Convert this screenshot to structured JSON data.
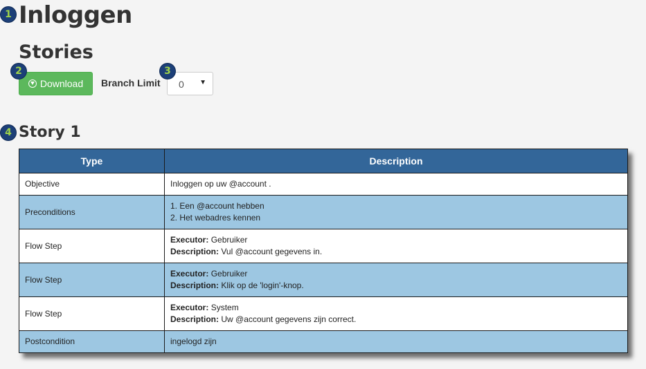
{
  "badges": [
    "1",
    "2",
    "3",
    "4"
  ],
  "page_title": "Inloggen",
  "section_title": "Stories",
  "download_button": {
    "label": "Download",
    "icon": "download-circle-icon",
    "color": "#5cb85c"
  },
  "branch_limit": {
    "label": "Branch Limit",
    "selected": "0"
  },
  "story": {
    "title": "Story 1",
    "headers": [
      "Type",
      "Description"
    ],
    "header_color": "#336699",
    "alt_row_color": "#9dc7e2",
    "rows": [
      {
        "type": "Objective",
        "text": "Inloggen op uw @account ."
      },
      {
        "type": "Preconditions",
        "lines": [
          "1. Een @account hebben",
          "2. Het webadres kennen"
        ]
      },
      {
        "type": "Flow Step",
        "executor_label": "Executor:",
        "executor": "Gebruiker",
        "description_label": "Description:",
        "description": "Vul @account gegevens in."
      },
      {
        "type": "Flow Step",
        "executor_label": "Executor:",
        "executor": "Gebruiker",
        "description_label": "Description:",
        "description": "Klik op de 'login'-knop."
      },
      {
        "type": "Flow Step",
        "executor_label": "Executor:",
        "executor": "System",
        "description_label": "Description:",
        "description": "Uw @account gegevens zijn correct."
      },
      {
        "type": "Postcondition",
        "text": "ingelogd zijn"
      }
    ]
  }
}
